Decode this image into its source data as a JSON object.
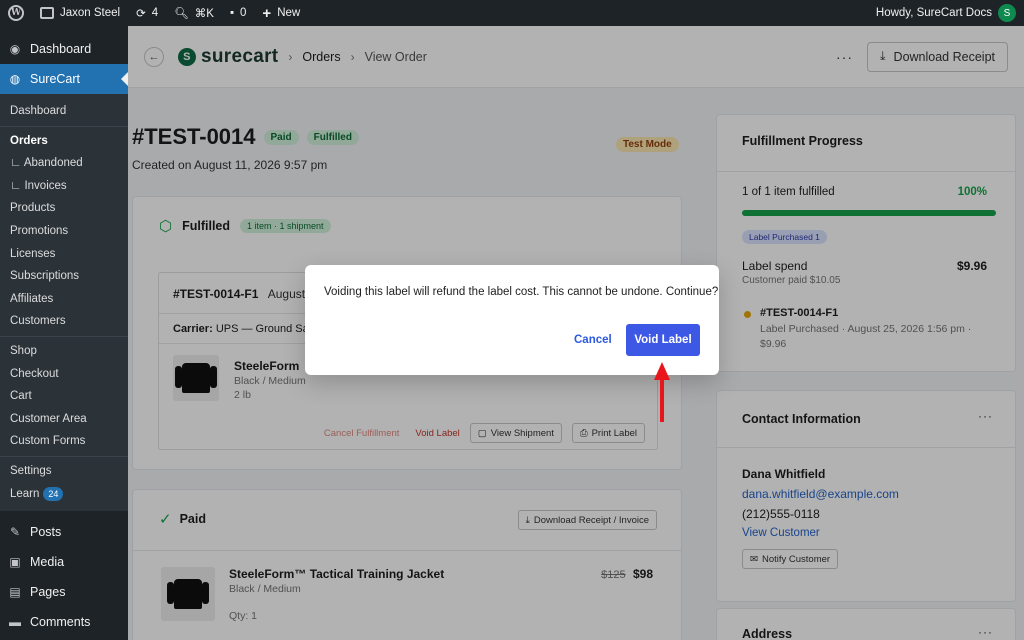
{
  "adminbar": {
    "site_name": "Jaxon Steel",
    "updates_count": "4",
    "search_shortcut": "⌘K",
    "comments_count": "0",
    "new_label": "New",
    "howdy": "Howdy, SureCart Docs"
  },
  "sidebar": {
    "dashboard": "Dashboard",
    "surecart": "SureCart",
    "items": [
      {
        "label": "Dashboard",
        "bold": false
      },
      {
        "label": "Orders",
        "bold": true
      },
      {
        "label": "∟ Abandoned",
        "bold": false
      },
      {
        "label": "∟ Invoices",
        "bold": false
      },
      {
        "label": "Products",
        "bold": false
      },
      {
        "label": "Promotions",
        "bold": false
      },
      {
        "label": "Licenses",
        "bold": false
      },
      {
        "label": "Subscriptions",
        "bold": false
      },
      {
        "label": "Affiliates",
        "bold": false
      },
      {
        "label": "Customers",
        "bold": false
      },
      {
        "label": "Shop",
        "bold": false
      },
      {
        "label": "Checkout",
        "bold": false
      },
      {
        "label": "Cart",
        "bold": false
      },
      {
        "label": "Customer Area",
        "bold": false
      },
      {
        "label": "Custom Forms",
        "bold": false
      },
      {
        "label": "Settings",
        "bold": false
      },
      {
        "label": "Learn",
        "bold": false
      }
    ],
    "learn_badge": "24",
    "posts": "Posts",
    "media": "Media",
    "pages": "Pages",
    "comments": "Comments"
  },
  "topbar": {
    "brand": "surecart",
    "crumb_orders": "Orders",
    "crumb_view": "View Order",
    "download_receipt": "Download Receipt"
  },
  "order": {
    "number": "#TEST-0014",
    "status_paid": "Paid",
    "status_fulfilled": "Fulfilled",
    "test_mode": "Test Mode",
    "created": "Created on August 11, 2026 9:57 pm"
  },
  "fulfilled_card": {
    "title": "Fulfilled",
    "badge": "1 item · 1 shipment",
    "shipment_id": "#TEST-0014-F1",
    "shipment_date": "August 2",
    "carrier_label": "Carrier:",
    "carrier_value": "UPS — Ground Sav",
    "product_name": "SteeleForm",
    "variant": "Black / Medium",
    "weight": "2 lb",
    "cancel_fulfillment": "Cancel Fulfillment",
    "void_label": "Void Label",
    "view_shipment": "View Shipment",
    "print_label": "Print Label"
  },
  "paid_card": {
    "title": "Paid",
    "download": "Download Receipt / Invoice",
    "product_name": "SteeleForm™ Tactical Training Jacket",
    "variant": "Black / Medium",
    "qty": "Qty: 1",
    "old_price": "$125",
    "price": "$98"
  },
  "progress_card": {
    "title": "Fulfillment Progress",
    "summary": "1 of 1 item fulfilled",
    "percent_text": "100%",
    "percent": 100,
    "label_badge": "Label Purchased 1",
    "label_spend": "Label spend",
    "label_spend_value": "$9.96",
    "customer_paid": "Customer paid $10.05",
    "event_id": "#TEST-0014-F1",
    "event_desc": "Label Purchased · August 25, 2026 1:56 pm ·",
    "event_amount": "$9.96"
  },
  "contact_card": {
    "title": "Contact Information",
    "name": "Dana Whitfield",
    "email": "dana.whitfield@example.com",
    "phone": "(212)555-0118",
    "view_customer": "View Customer",
    "notify": "Notify Customer"
  },
  "address_card": {
    "title": "Address"
  },
  "modal": {
    "message": "Voiding this label will refund the label cost. This cannot be undone. Continue?",
    "cancel": "Cancel",
    "confirm": "Void Label"
  },
  "colors": {
    "accent": "#3e58e6",
    "wp_blue": "#2271b1",
    "success": "#16a34a",
    "annotation_arrow": "#e8161b"
  }
}
